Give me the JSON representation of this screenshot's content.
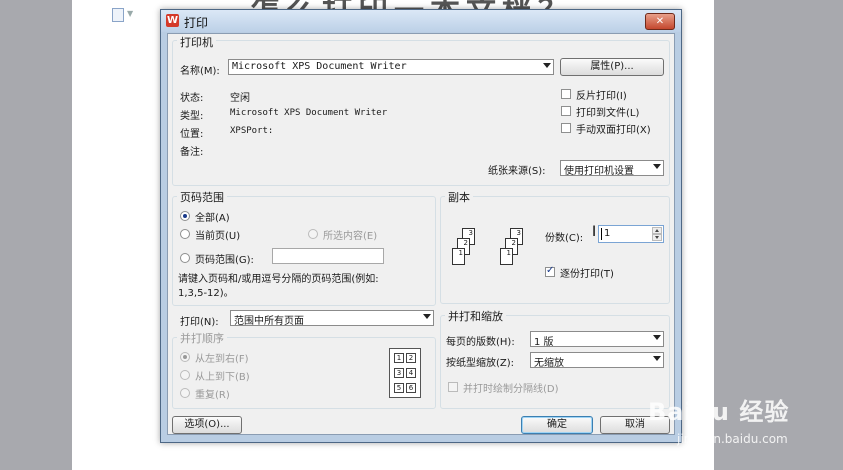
{
  "background": {
    "heading_fragment": "怎么打印一本文档？",
    "watermark": "Baidu 经验",
    "watermark_url": "jingyan.baidu.com"
  },
  "dialog": {
    "app_icon": "W",
    "title": "打印",
    "close": "✕"
  },
  "printer": {
    "group_title": "打印机",
    "name_label": "名称(M):",
    "name_value": "Microsoft XPS Document Writer",
    "properties_button": "属性(P)...",
    "status_label": "状态:",
    "status_value": "空闲",
    "type_label": "类型:",
    "type_value": "Microsoft XPS Document Writer",
    "where_label": "位置:",
    "where_value": "XPSPort:",
    "comment_label": "备注:",
    "reverse_print": {
      "label": "反片打印(I)",
      "checked": false
    },
    "print_to_file": {
      "label": "打印到文件(L)",
      "checked": false
    },
    "manual_duplex": {
      "label": "手动双面打印(X)",
      "checked": false
    },
    "paper_source_label": "纸张来源(S):",
    "paper_source_value": "使用打印机设置"
  },
  "page_range": {
    "group_title": "页码范围",
    "all": {
      "label": "全部(A)",
      "selected": true
    },
    "current": {
      "label": "当前页(U)",
      "selected": false
    },
    "selection": {
      "label": "所选内容(E)",
      "selected": false
    },
    "pages": {
      "label": "页码范围(G):",
      "selected": false,
      "value": ""
    },
    "hint": "请键入页码和/或用逗号分隔的页码范围(例如:",
    "hint_example": "1,3,5-12)。"
  },
  "print_what": {
    "label": "打印(N):",
    "value": "范围中所有页面"
  },
  "collate_order": {
    "group_title": "并打顺序",
    "left_to_right": {
      "label": "从左到右(F)",
      "selected": true
    },
    "top_to_bottom": {
      "label": "从上到下(B)",
      "selected": false
    },
    "repeat": {
      "label": "重复(R)",
      "selected": false
    },
    "preview_numbers": [
      "1",
      "2",
      "3",
      "4",
      "5",
      "6"
    ]
  },
  "copies": {
    "group_title": "副本",
    "count_label": "份数(C):",
    "count_value": "1",
    "collate": {
      "label": "逐份打印(T)",
      "checked": true
    },
    "page_numbers": [
      "3",
      "2",
      "1"
    ]
  },
  "zoom": {
    "group_title": "并打和缩放",
    "pages_per_sheet_label": "每页的版数(H):",
    "pages_per_sheet_value": "1 版",
    "scale_label": "按纸型缩放(Z):",
    "scale_value": "无缩放",
    "draw_borders": {
      "label": "并打时绘制分隔线(D)",
      "checked": false
    }
  },
  "buttons": {
    "options": "选项(O)...",
    "ok": "确定",
    "cancel": "取消"
  }
}
